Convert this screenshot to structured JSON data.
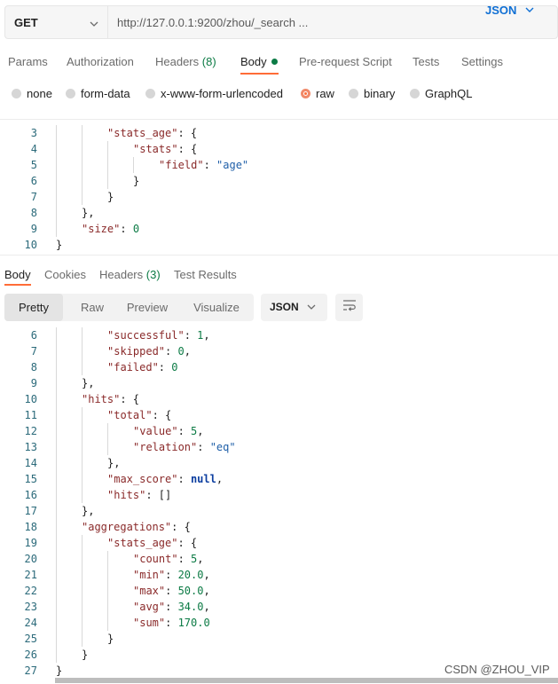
{
  "request": {
    "method": "GET",
    "url": "http://127.0.0.1:9200/zhou/_search ..."
  },
  "request_tabs": [
    {
      "label": "Params"
    },
    {
      "label": "Authorization"
    },
    {
      "label": "Headers",
      "count": "(8)"
    },
    {
      "label": "Body",
      "active": true
    },
    {
      "label": "Pre-request Script"
    },
    {
      "label": "Tests"
    },
    {
      "label": "Settings"
    }
  ],
  "body_types": [
    {
      "label": "none"
    },
    {
      "label": "form-data"
    },
    {
      "label": "x-www-form-urlencoded"
    },
    {
      "label": "raw",
      "selected": true
    },
    {
      "label": "binary"
    },
    {
      "label": "GraphQL"
    }
  ],
  "body_format": "JSON",
  "request_body_lines": [
    {
      "n": "3",
      "indent": 2,
      "tokens": [
        [
          "key",
          "\"stats_age\""
        ],
        [
          "p",
          ": {"
        ]
      ]
    },
    {
      "n": "4",
      "indent": 3,
      "tokens": [
        [
          "key",
          "\"stats\""
        ],
        [
          "p",
          ": {"
        ]
      ]
    },
    {
      "n": "5",
      "indent": 4,
      "tokens": [
        [
          "key",
          "\"field\""
        ],
        [
          "p",
          ": "
        ],
        [
          "str",
          "\"age\""
        ]
      ]
    },
    {
      "n": "6",
      "indent": 3,
      "tokens": [
        [
          "p",
          "}"
        ]
      ]
    },
    {
      "n": "7",
      "indent": 2,
      "tokens": [
        [
          "p",
          "}"
        ]
      ]
    },
    {
      "n": "8",
      "indent": 1,
      "tokens": [
        [
          "p",
          "},"
        ]
      ]
    },
    {
      "n": "9",
      "indent": 1,
      "tokens": [
        [
          "key",
          "\"size\""
        ],
        [
          "p",
          ": "
        ],
        [
          "num",
          "0"
        ]
      ]
    },
    {
      "n": "10",
      "indent": 0,
      "tokens": [
        [
          "p",
          "}"
        ]
      ]
    }
  ],
  "response_tabs": [
    {
      "label": "Body",
      "active": true
    },
    {
      "label": "Cookies"
    },
    {
      "label": "Headers",
      "count": "(3)"
    },
    {
      "label": "Test Results"
    }
  ],
  "view_modes": [
    "Pretty",
    "Raw",
    "Preview",
    "Visualize"
  ],
  "active_view": "Pretty",
  "response_format": "JSON",
  "response_lines": [
    {
      "n": "6",
      "indent": 2,
      "tokens": [
        [
          "key",
          "\"successful\""
        ],
        [
          "p",
          ": "
        ],
        [
          "num",
          "1"
        ],
        [
          "p",
          ","
        ]
      ]
    },
    {
      "n": "7",
      "indent": 2,
      "tokens": [
        [
          "key",
          "\"skipped\""
        ],
        [
          "p",
          ": "
        ],
        [
          "num",
          "0"
        ],
        [
          "p",
          ","
        ]
      ]
    },
    {
      "n": "8",
      "indent": 2,
      "tokens": [
        [
          "key",
          "\"failed\""
        ],
        [
          "p",
          ": "
        ],
        [
          "num",
          "0"
        ]
      ]
    },
    {
      "n": "9",
      "indent": 1,
      "tokens": [
        [
          "p",
          "},"
        ]
      ]
    },
    {
      "n": "10",
      "indent": 1,
      "tokens": [
        [
          "key",
          "\"hits\""
        ],
        [
          "p",
          ": {"
        ]
      ]
    },
    {
      "n": "11",
      "indent": 2,
      "tokens": [
        [
          "key",
          "\"total\""
        ],
        [
          "p",
          ": {"
        ]
      ]
    },
    {
      "n": "12",
      "indent": 3,
      "tokens": [
        [
          "key",
          "\"value\""
        ],
        [
          "p",
          ": "
        ],
        [
          "num",
          "5"
        ],
        [
          "p",
          ","
        ]
      ]
    },
    {
      "n": "13",
      "indent": 3,
      "tokens": [
        [
          "key",
          "\"relation\""
        ],
        [
          "p",
          ": "
        ],
        [
          "str",
          "\"eq\""
        ]
      ]
    },
    {
      "n": "14",
      "indent": 2,
      "tokens": [
        [
          "p",
          "},"
        ]
      ]
    },
    {
      "n": "15",
      "indent": 2,
      "tokens": [
        [
          "key",
          "\"max_score\""
        ],
        [
          "p",
          ": "
        ],
        [
          "kw",
          "null"
        ],
        [
          "p",
          ","
        ]
      ]
    },
    {
      "n": "16",
      "indent": 2,
      "tokens": [
        [
          "key",
          "\"hits\""
        ],
        [
          "p",
          ": []"
        ]
      ]
    },
    {
      "n": "17",
      "indent": 1,
      "tokens": [
        [
          "p",
          "},"
        ]
      ]
    },
    {
      "n": "18",
      "indent": 1,
      "tokens": [
        [
          "key",
          "\"aggregations\""
        ],
        [
          "p",
          ": {"
        ]
      ]
    },
    {
      "n": "19",
      "indent": 2,
      "tokens": [
        [
          "key",
          "\"stats_age\""
        ],
        [
          "p",
          ": {"
        ]
      ]
    },
    {
      "n": "20",
      "indent": 3,
      "tokens": [
        [
          "key",
          "\"count\""
        ],
        [
          "p",
          ": "
        ],
        [
          "num",
          "5"
        ],
        [
          "p",
          ","
        ]
      ]
    },
    {
      "n": "21",
      "indent": 3,
      "tokens": [
        [
          "key",
          "\"min\""
        ],
        [
          "p",
          ": "
        ],
        [
          "num",
          "20.0"
        ],
        [
          "p",
          ","
        ]
      ]
    },
    {
      "n": "22",
      "indent": 3,
      "tokens": [
        [
          "key",
          "\"max\""
        ],
        [
          "p",
          ": "
        ],
        [
          "num",
          "50.0"
        ],
        [
          "p",
          ","
        ]
      ]
    },
    {
      "n": "23",
      "indent": 3,
      "tokens": [
        [
          "key",
          "\"avg\""
        ],
        [
          "p",
          ": "
        ],
        [
          "num",
          "34.0"
        ],
        [
          "p",
          ","
        ]
      ]
    },
    {
      "n": "24",
      "indent": 3,
      "tokens": [
        [
          "key",
          "\"sum\""
        ],
        [
          "p",
          ": "
        ],
        [
          "num",
          "170.0"
        ]
      ]
    },
    {
      "n": "25",
      "indent": 2,
      "tokens": [
        [
          "p",
          "}"
        ]
      ]
    },
    {
      "n": "26",
      "indent": 1,
      "tokens": [
        [
          "p",
          "}"
        ]
      ]
    },
    {
      "n": "27",
      "indent": 0,
      "tokens": [
        [
          "p",
          "}"
        ]
      ]
    }
  ],
  "watermark": "CSDN @ZHOU_VIP",
  "icons": {
    "method_chevron": "chevron-down-icon",
    "format_chevron": "chevron-down-icon",
    "wrap": "wrap-lines-icon"
  },
  "colors": {
    "accent": "#ff6c37",
    "count_green": "#0c7b45",
    "json_blue": "#0f6fd4"
  }
}
